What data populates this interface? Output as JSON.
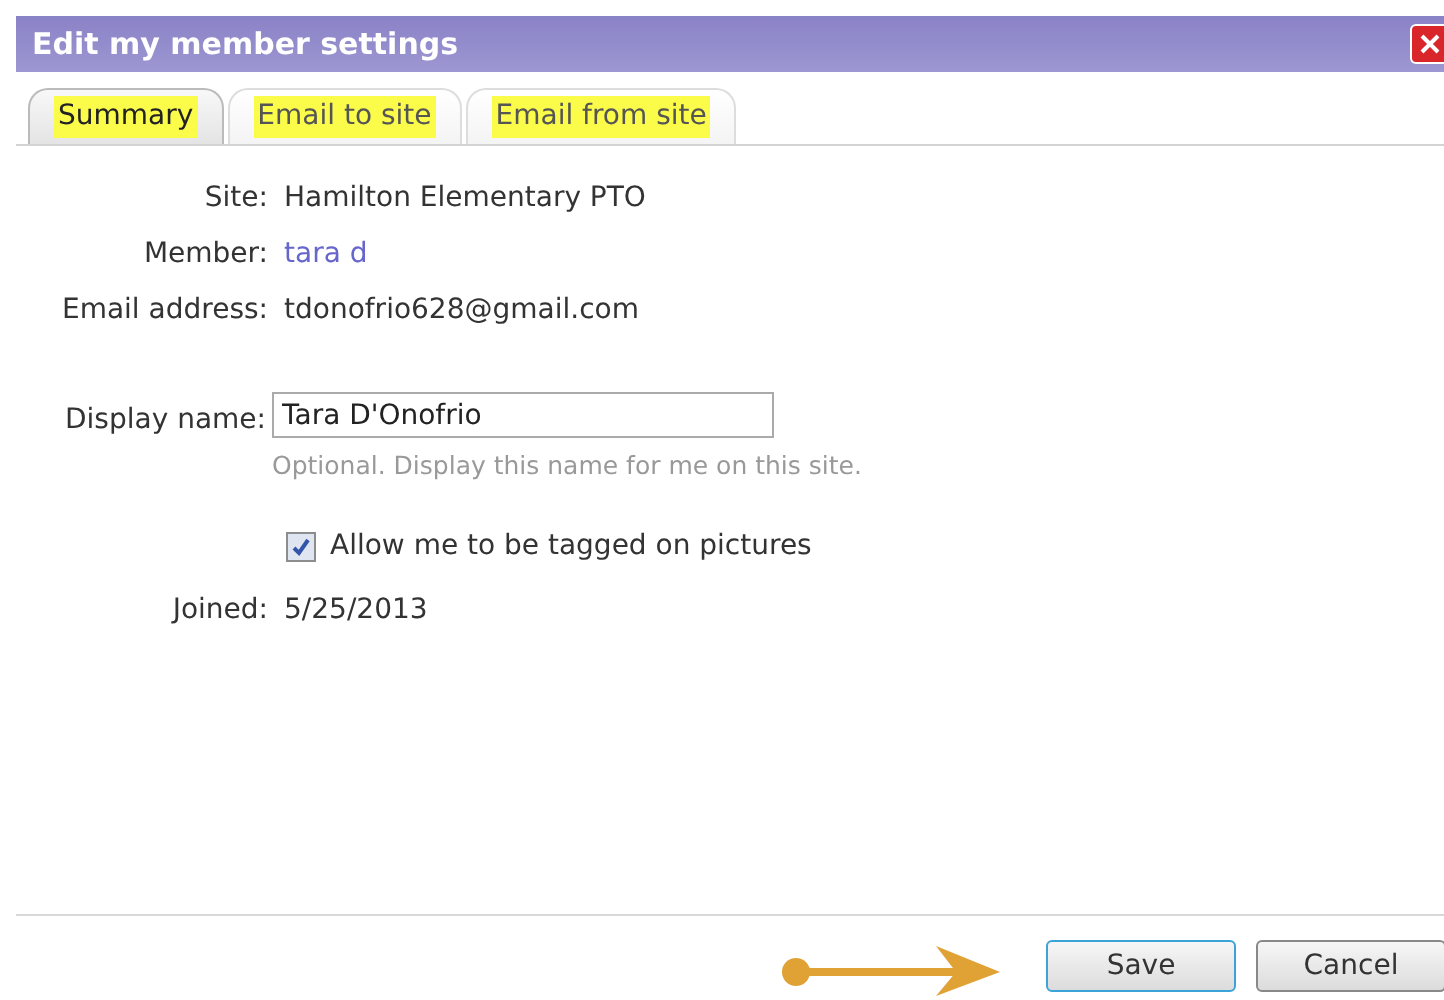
{
  "window": {
    "title": "Edit my member settings"
  },
  "tabs": [
    {
      "label": "Summary",
      "selected": true,
      "highlighted": true
    },
    {
      "label": "Email to site",
      "selected": false,
      "highlighted": true
    },
    {
      "label": "Email from site",
      "selected": false,
      "highlighted": true
    }
  ],
  "info": [
    {
      "label": "Site:",
      "value": "Hamilton Elementary PTO",
      "kind": "text"
    },
    {
      "label": "Member:",
      "value": "tara d",
      "kind": "link"
    },
    {
      "label": "Email address:",
      "value": "tdonofrio628@gmail.com",
      "kind": "text"
    }
  ],
  "display_name": {
    "label": "Display name:",
    "value": "Tara D'Onofrio",
    "hint": "Optional. Display this name for me on this site."
  },
  "tagging": {
    "label": "Allow me to be tagged on pictures",
    "checked": true
  },
  "joined": {
    "label": "Joined:",
    "value": "5/25/2013"
  },
  "buttons": [
    {
      "label": "Save",
      "focused": true
    },
    {
      "label": "Cancel",
      "focused": false
    }
  ]
}
